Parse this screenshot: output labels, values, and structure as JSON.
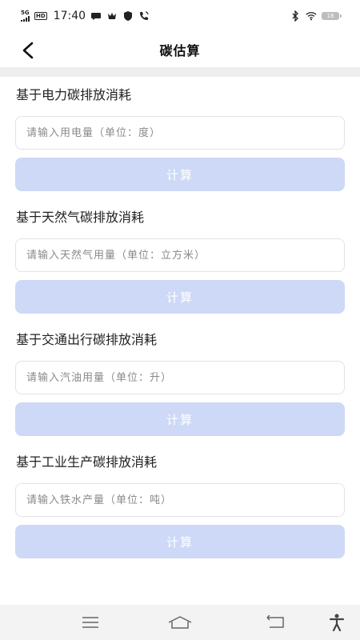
{
  "status_bar": {
    "network": "5G",
    "hd_badge": "HD",
    "time": "17:40",
    "battery": "18"
  },
  "header": {
    "title": "碳估算"
  },
  "sections": [
    {
      "title": "基于电力碳排放消耗",
      "placeholder": "请输入用电量（单位：度）",
      "button_label": "计算"
    },
    {
      "title": "基于天然气碳排放消耗",
      "placeholder": "请输入天然气用量（单位：立方米）",
      "button_label": "计算"
    },
    {
      "title": "基于交通出行碳排放消耗",
      "placeholder": "请输入汽油用量（单位：升）",
      "button_label": "计算"
    },
    {
      "title": "基于工业生产碳排放消耗",
      "placeholder": "请输入铁水产量（单位：吨）",
      "button_label": "计算"
    }
  ],
  "colors": {
    "button_bg": "#cdd9f6",
    "divider": "#eeeeee",
    "nav_bg": "#f3f3f3"
  },
  "nav_icons": [
    "menu-icon",
    "home-icon",
    "back-icon",
    "accessibility-icon"
  ]
}
